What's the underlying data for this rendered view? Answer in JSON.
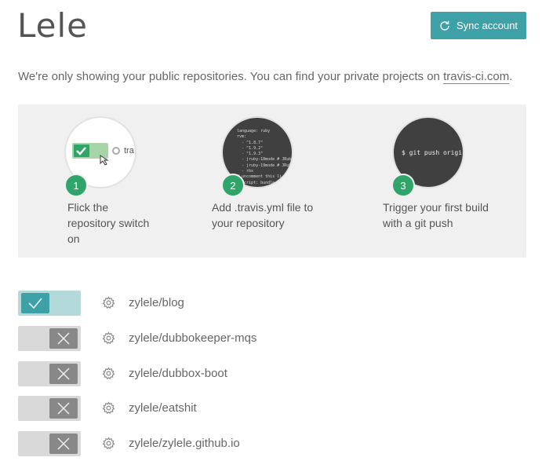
{
  "header": {
    "title": "Lele",
    "sync_button_label": "Sync account",
    "sync_icon": "refresh-icon"
  },
  "notice": {
    "text": "We're only showing your public repositories. You can find your private projects on ",
    "link_text": "travis-ci.com",
    "suffix": "."
  },
  "steps": [
    {
      "number": "1",
      "line1": "Flick the",
      "line2": "repository switch",
      "line3": "on",
      "illustration_text": "tra"
    },
    {
      "number": "2",
      "line1": "Add .travis.yml file to",
      "line2": "your repository",
      "code": "language: ruby\nrvm:\n  - \"1.8.7\"\n  - \"1.9.2\"\n  - \"1.9.3\"\n  - jruby-18mode # JRuby\n  - jruby-19mode # JRuby\n  - rbx\n# uncomment this li\n  script: bundle"
    },
    {
      "number": "3",
      "line1": "Trigger your first build",
      "line2": "with a git push",
      "command": "$ git push origin"
    }
  ],
  "repos": [
    {
      "name": "zylele/blog",
      "enabled": true
    },
    {
      "name": "zylele/dubbokeeper-mqs",
      "enabled": false
    },
    {
      "name": "zylele/dubbox-boot",
      "enabled": false
    },
    {
      "name": "zylele/eatshit",
      "enabled": false
    },
    {
      "name": "zylele/zylele.github.io",
      "enabled": false
    }
  ],
  "colors": {
    "accent": "#3ea1a7",
    "step_badge": "#2fa569",
    "toggle_on_track": "#b4d9db",
    "toggle_off_track": "#d9d9d9",
    "toggle_off_knob": "#888888"
  }
}
